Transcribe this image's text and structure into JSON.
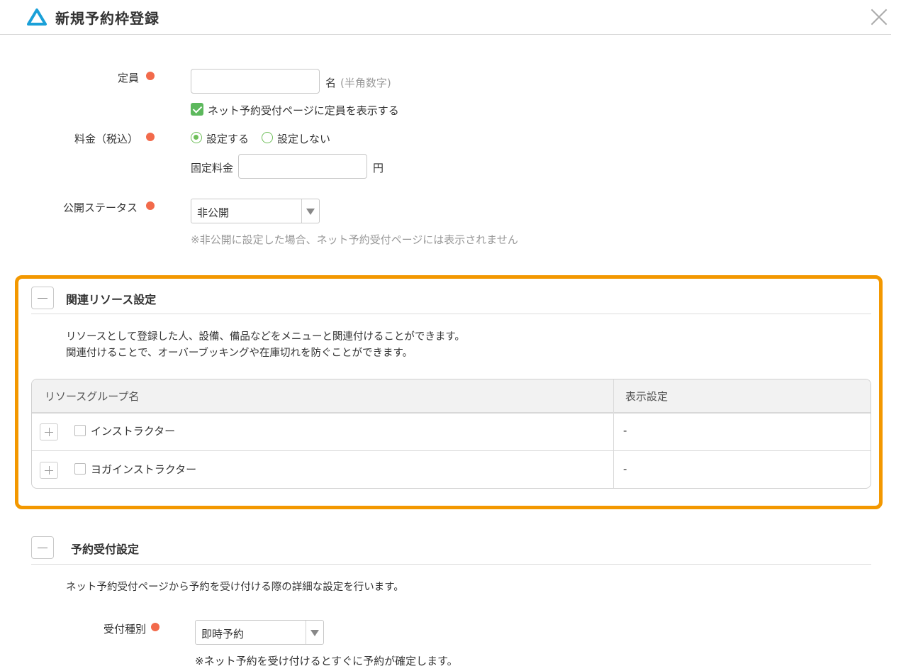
{
  "header": {
    "title": "新規予約枠登録",
    "logo_icon": "triangle-logo-icon",
    "close_icon": "close-icon"
  },
  "capacity": {
    "label": "定員",
    "value": "",
    "unit": "名",
    "hint": "(半角数字)",
    "show_checkbox_label": "ネット予約受付ページに定員を表示する",
    "show_checked": true
  },
  "price": {
    "label": "料金（税込）",
    "options": [
      "設定する",
      "設定しない"
    ],
    "selected": "設定する",
    "fixed_label": "固定料金",
    "fixed_value": "",
    "unit": "円"
  },
  "status": {
    "label": "公開ステータス",
    "selected": "非公開",
    "note": "※非公開に設定した場合、ネット予約受付ページには表示されません"
  },
  "resource_section": {
    "title": "関連リソース設定",
    "desc_line1": "リソースとして登録した人、設備、備品などをメニューと関連付けることができます。",
    "desc_line2": "関連付けることで、オーバーブッキングや在庫切れを防ぐことができます。",
    "table": {
      "headers": [
        "リソースグループ名",
        "表示設定"
      ],
      "rows": [
        {
          "name": "インストラクター",
          "display": "-"
        },
        {
          "name": "ヨガインストラクター",
          "display": "-"
        }
      ]
    }
  },
  "booking_section": {
    "title": "予約受付設定",
    "desc": "ネット予約受付ページから予約を受け付ける際の詳細な設定を行います。",
    "type_label": "受付種別",
    "type_selected": "即時予約",
    "type_note": "※ネット予約を受け付けるとすぐに予約が確定します。"
  },
  "colors": {
    "required_dot": "#f26a4b",
    "accent_green": "#5cb85c",
    "highlight_border": "#f39800",
    "logo": "#1aa0d8"
  }
}
